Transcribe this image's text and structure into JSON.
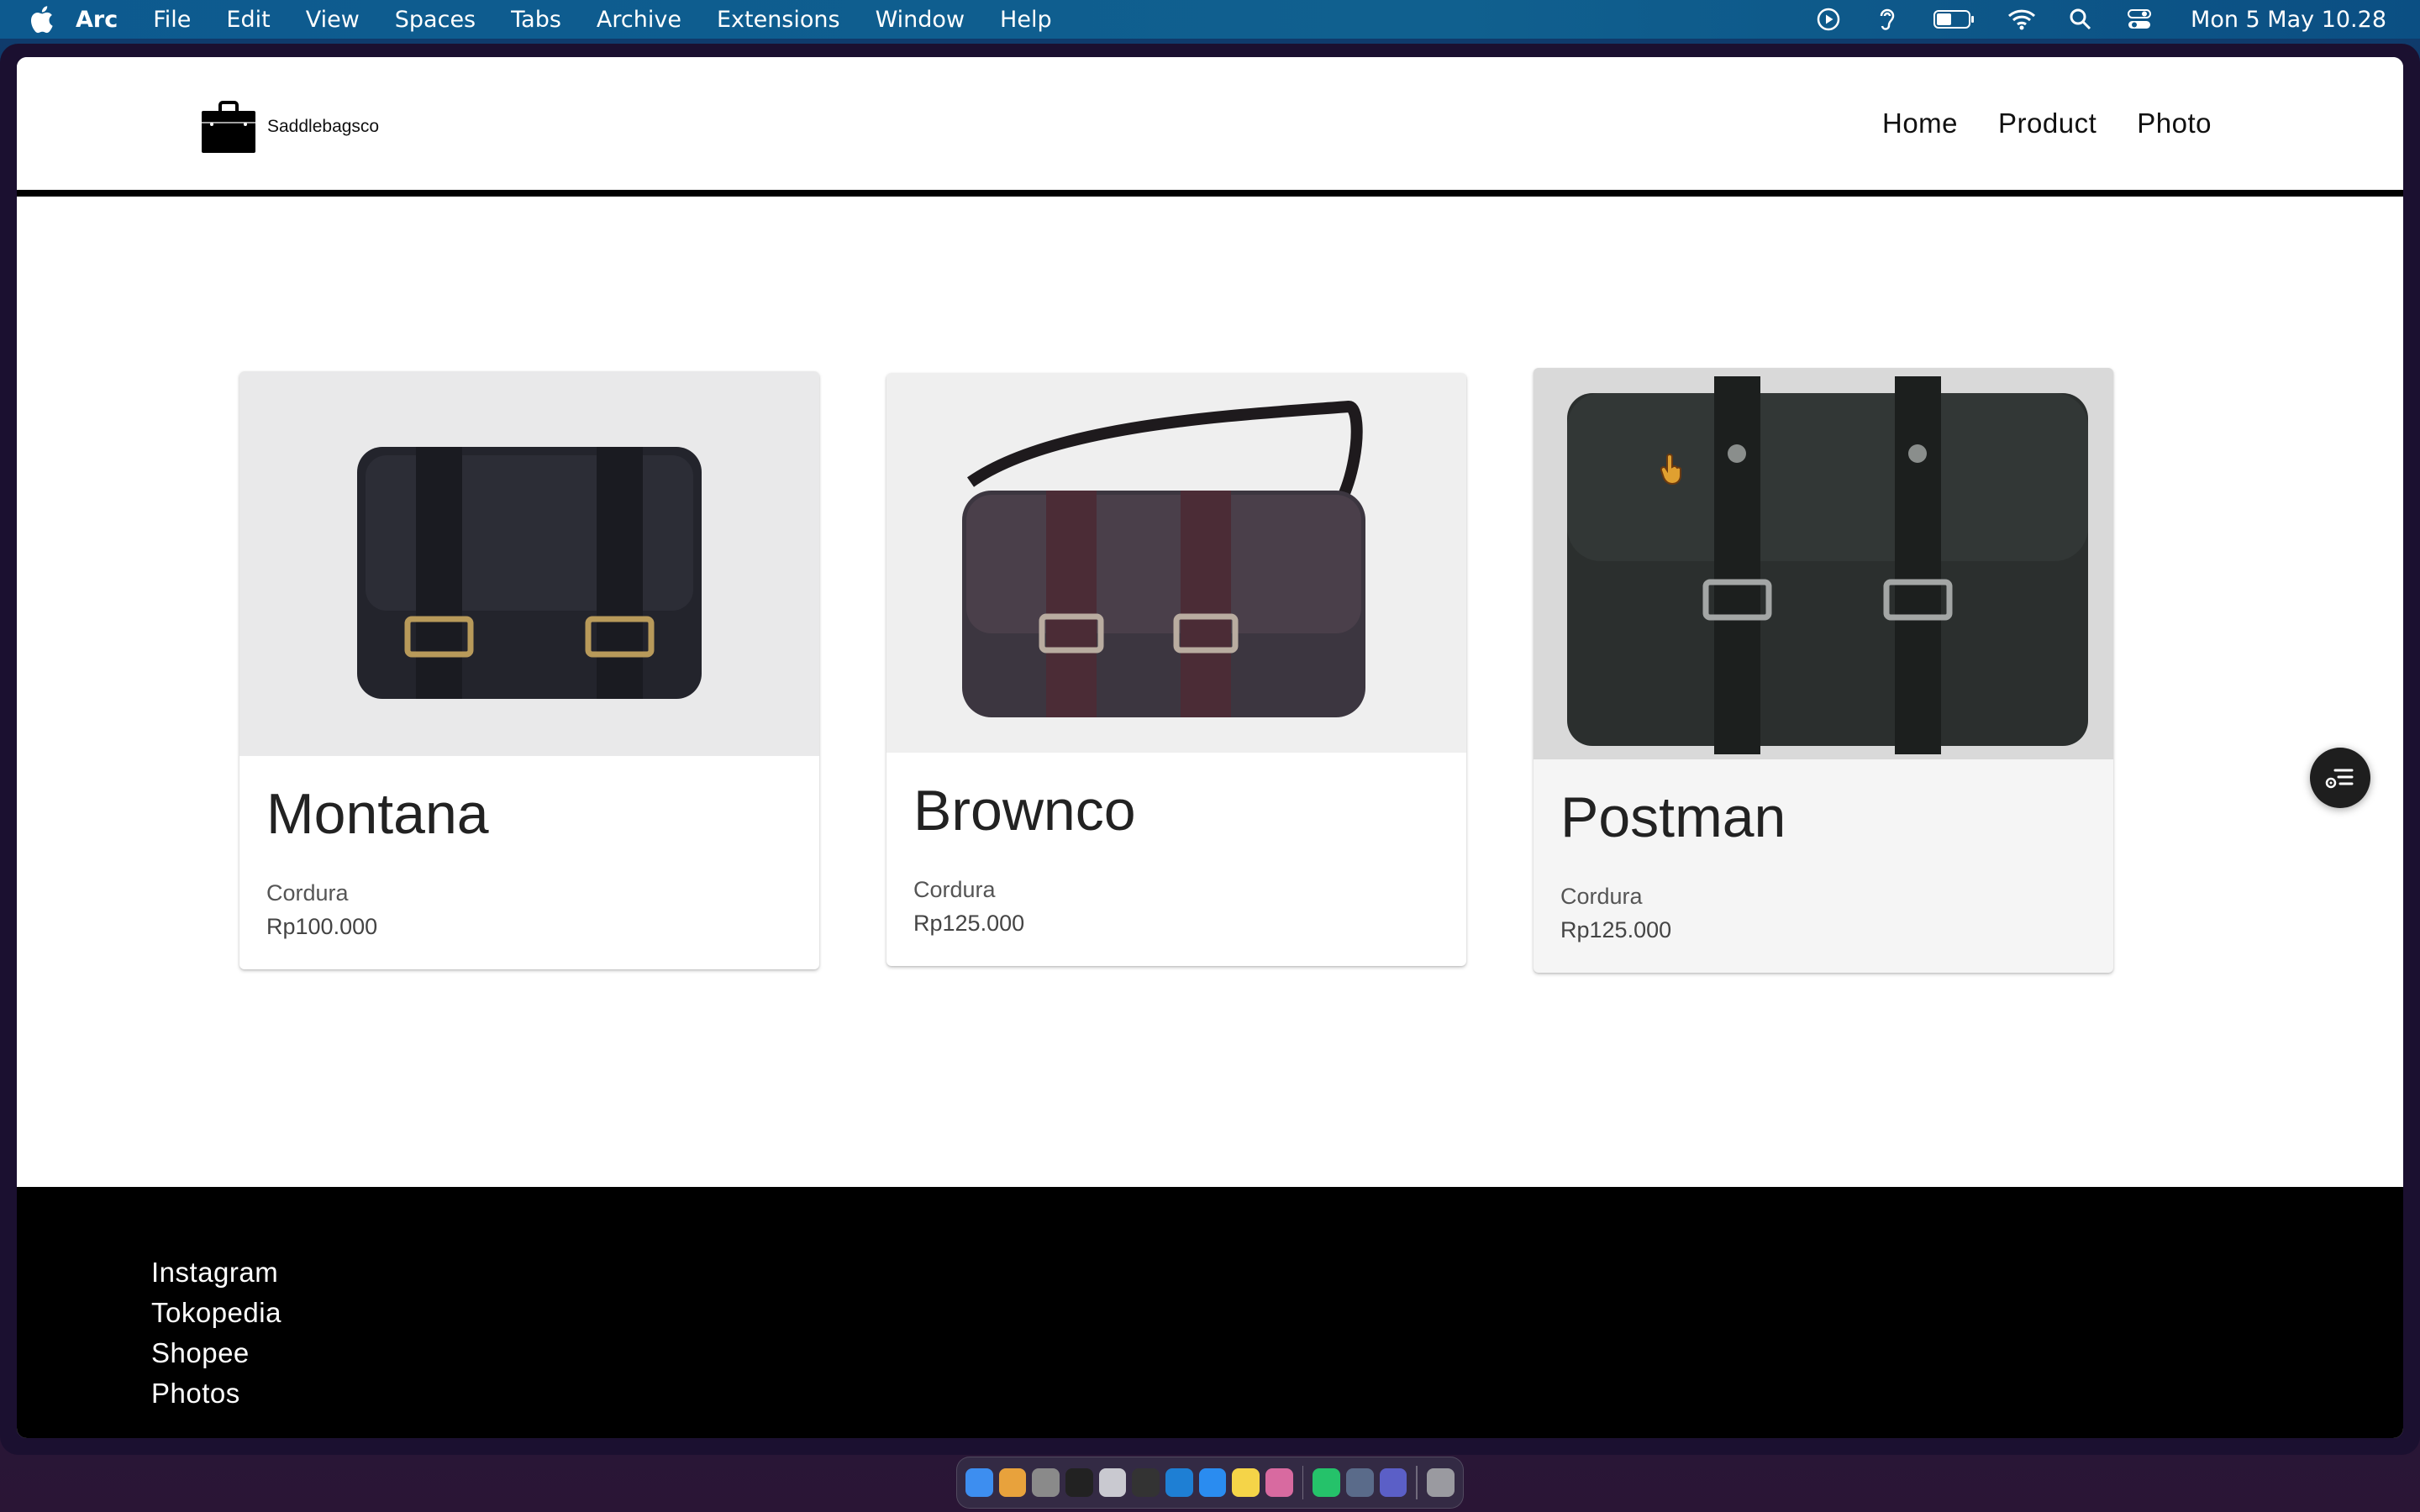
{
  "menubar": {
    "app_name": "Arc",
    "items": [
      "File",
      "Edit",
      "View",
      "Spaces",
      "Tabs",
      "Archive",
      "Extensions",
      "Window",
      "Help"
    ],
    "clock": "Mon 5 May  10.28",
    "status_icons": [
      "play-circle-icon",
      "hearing-icon",
      "battery-icon",
      "wifi-icon",
      "search-icon",
      "control-center-icon"
    ]
  },
  "site": {
    "logo_text": "Saddlebagsco",
    "nav": [
      "Home",
      "Product",
      "Photo"
    ]
  },
  "products": [
    {
      "name": "Montana",
      "material": "Cordura",
      "price": "Rp100.000",
      "image_color": "#2a2b33",
      "bg": "#e9e9ea"
    },
    {
      "name": "Brownco",
      "material": "Cordura",
      "price": "Rp125.000",
      "image_color": "#3d3038",
      "bg": "#eeeeee"
    },
    {
      "name": "Postman",
      "material": "Cordura",
      "price": "Rp125.000",
      "image_color": "#2b2f2e",
      "bg": "#d8d8d8"
    }
  ],
  "footer": {
    "links": [
      "Instagram",
      "Tokopedia",
      "Shopee",
      "Photos"
    ]
  },
  "dock": {
    "icons": [
      "finder-icon",
      "launchpad-icon",
      "system-settings-icon",
      "terminal-icon",
      "disk-utility-icon",
      "activity-monitor-icon",
      "vscode-icon",
      "safari-icon",
      "notes-icon",
      "image-app-icon",
      "whatsapp-icon",
      "screen-sharing-icon",
      "teams-icon",
      "trash-icon"
    ],
    "colors": [
      "#3d8ef0",
      "#e8a23c",
      "#8a8a8a",
      "#222222",
      "#c9c9d0",
      "#333333",
      "#1e7fd4",
      "#2a8cf0",
      "#f5d448",
      "#d86aa0",
      "#25c26a",
      "#5a6b8a",
      "#5b5fc7",
      "#9a9aa0"
    ]
  }
}
